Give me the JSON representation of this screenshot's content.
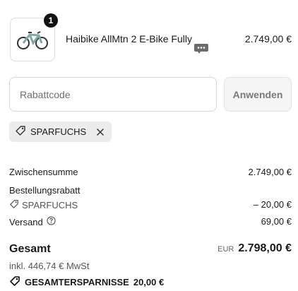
{
  "line_item": {
    "quantity": "1",
    "name": "Haibike AllMtn 2 E-Bike Fully",
    "price": "2.749,00 €"
  },
  "discount": {
    "placeholder": "Rabattcode",
    "apply_label": "Anwenden",
    "applied_code": "SPARFUCHS"
  },
  "summary": {
    "subtotal_label": "Zwischensumme",
    "subtotal_value": "2.749,00 €",
    "order_discount_label": "Bestellungsrabatt",
    "order_discount_code": "SPARFUCHS",
    "order_discount_value": "– 20,00 €",
    "shipping_label": "Versand",
    "shipping_value": "69,00 €",
    "total_label": "Gesamt",
    "currency": "EUR",
    "total_value": "2.798,00 €",
    "tax_note": "inkl. 446,74 € MwSt",
    "savings_label": "GESAMTERSPARNISSE",
    "savings_value": "20,00 €"
  },
  "colors": {
    "text": "#1a1a1a",
    "muted": "#555555",
    "chip_bg": "#ececec",
    "border": "#d9d9d9"
  }
}
